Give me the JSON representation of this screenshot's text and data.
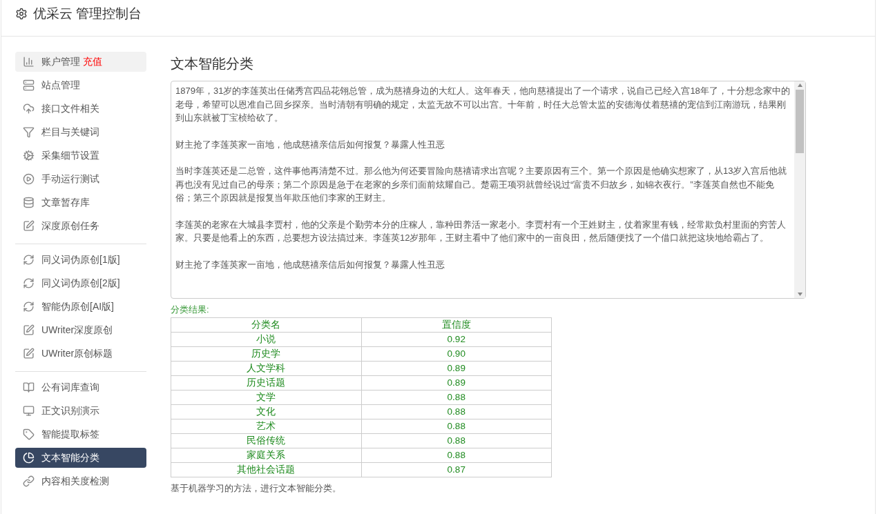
{
  "header": {
    "title": "优采云 管理控制台"
  },
  "sidebar": {
    "groups": [
      {
        "items": [
          {
            "label": "账户管理",
            "badge": "充值",
            "highlighted": true,
            "selected": false
          },
          {
            "label": "站点管理",
            "highlighted": false,
            "selected": false
          },
          {
            "label": "接口文件相关",
            "highlighted": false,
            "selected": false
          },
          {
            "label": "栏目与关键词",
            "highlighted": false,
            "selected": false
          },
          {
            "label": "采集细节设置",
            "highlighted": false,
            "selected": false
          },
          {
            "label": "手动运行测试",
            "highlighted": false,
            "selected": false
          },
          {
            "label": "文章暂存库",
            "highlighted": false,
            "selected": false
          },
          {
            "label": "深度原创任务",
            "highlighted": false,
            "selected": false
          }
        ]
      },
      {
        "items": [
          {
            "label": "同义词伪原创[1版]",
            "highlighted": false,
            "selected": false
          },
          {
            "label": "同义词伪原创[2版]",
            "highlighted": false,
            "selected": false
          },
          {
            "label": "智能伪原创[AI版]",
            "highlighted": false,
            "selected": false
          },
          {
            "label": "UWriter深度原创",
            "highlighted": false,
            "selected": false
          },
          {
            "label": "UWriter原创标题",
            "highlighted": false,
            "selected": false
          }
        ]
      },
      {
        "items": [
          {
            "label": "公有词库查询",
            "highlighted": false,
            "selected": false
          },
          {
            "label": "正文识别演示",
            "highlighted": false,
            "selected": false
          },
          {
            "label": "智能提取标签",
            "highlighted": false,
            "selected": false
          },
          {
            "label": "文本智能分类",
            "highlighted": false,
            "selected": true
          },
          {
            "label": "内容相关度检测",
            "highlighted": false,
            "selected": false
          }
        ]
      }
    ]
  },
  "main": {
    "title": "文本智能分类",
    "input_text": [
      "1879年，31岁的李莲英出任储秀宫四品花翎总管，成为慈禧身边的大红人。这年春天，他向慈禧提出了一个请求，说自己已经入宫18年了，十分想念家中的老母，希望可以恩准自己回乡探亲。当时清朝有明确的规定，太监无故不可以出宫。十年前，时任大总管太监的安德海仗着慈禧的宠信到江南游玩，结果刚到山东就被丁宝桢给砍了。",
      "财主抢了李莲英家一亩地，他成慈禧亲信后如何报复？暴露人性丑恶",
      "当时李莲英还是二总管，这件事他再清楚不过。那么他为何还要冒险向慈禧请求出宫呢？主要原因有三个。第一个原因是他确实想家了，从13岁入宫后他就再也没有见过自己的母亲；第二个原因是急于在老家的乡亲们面前炫耀自己。楚霸王项羽就曾经说过“富贵不归故乡，如锦衣夜行。”李莲英自然也不能免俗；第三个原因就是报复当年欺压他们李家的王财主。",
      "李莲英的老家在大城县李贾村，他的父亲是个勤劳本分的庄稼人，靠种田养活一家老小。李贾村有一个王姓财主，仗着家里有钱，经常欺负村里面的穷苦人家。只要是他看上的东西，总要想方设法搞过来。李莲英12岁那年，王财主看中了他们家中的一亩良田，然后随便找了一个借口就把这块地给霸占了。",
      "财主抢了李莲英家一亩地，他成慈禧亲信后如何报复？暴露人性丑恶"
    ],
    "result_label": "分类结果:",
    "table": {
      "columns": [
        "分类名",
        "置信度"
      ],
      "rows": [
        [
          "小说",
          "0.92"
        ],
        [
          "历史学",
          "0.90"
        ],
        [
          "人文学科",
          "0.89"
        ],
        [
          "历史话题",
          "0.89"
        ],
        [
          "文学",
          "0.88"
        ],
        [
          "文化",
          "0.88"
        ],
        [
          "艺术",
          "0.88"
        ],
        [
          "民俗传统",
          "0.88"
        ],
        [
          "家庭关系",
          "0.88"
        ],
        [
          "其他社会话题",
          "0.87"
        ]
      ]
    },
    "footer_text": "基于机器学习的方法，进行文本智能分类。"
  }
}
